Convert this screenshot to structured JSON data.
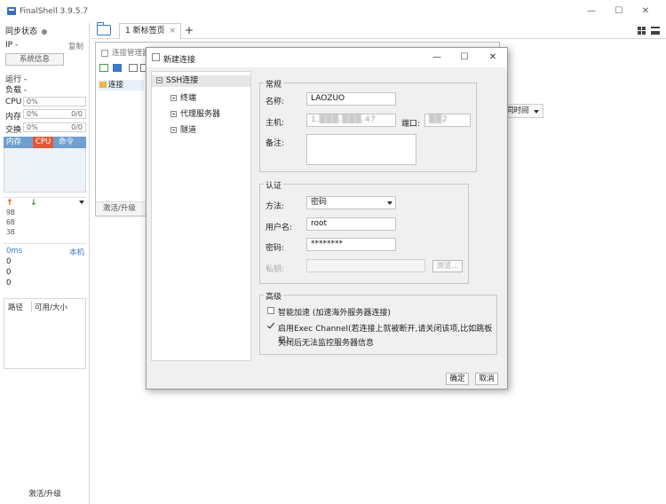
{
  "app": {
    "title": "FinalShell 3.9.5.7"
  },
  "sidebar": {
    "sync_label": "同步状态",
    "ip_label": "IP -",
    "copy_label": "复制",
    "sysinfo_button": "系统信息",
    "running_label": "运行 -",
    "load_label": "负载 -",
    "cpu": {
      "label": "CPU",
      "value": "0%"
    },
    "mem": {
      "label": "内存",
      "value": "0%",
      "right": "0/0"
    },
    "swap": {
      "label": "交换",
      "value": "0%",
      "right": "0/0"
    },
    "proc_tabs": [
      "内存",
      "CPU",
      "命令"
    ],
    "net_labels": [
      "9B",
      "6B",
      "3B"
    ],
    "ping": {
      "value": "0ms",
      "host": "本机",
      "rows": [
        "0",
        "0",
        "0"
      ]
    },
    "disk_headers": [
      "路径",
      "可用/大小"
    ],
    "upgrade": "激活/升级"
  },
  "tabs": {
    "items": [
      {
        "label": "1 新标签页",
        "close": "×"
      }
    ],
    "add": "+"
  },
  "conn_manager": {
    "title": "连接管理器",
    "row": "连接",
    "footer": "激活/升级"
  },
  "time_select": "同时间",
  "dialog": {
    "title": "新建连接",
    "tree": {
      "root": "SSH连接",
      "children": [
        "终端",
        "代理服务器",
        "隧道"
      ]
    },
    "general": {
      "title": "常规",
      "name_label": "名称:",
      "name_value": "LAOZUO",
      "host_label": "主机:",
      "host_value": "1.▒▒▒.▒▒▒.47",
      "port_label": "端口:",
      "port_value": "▒▒2",
      "note_label": "备注:"
    },
    "auth": {
      "title": "认证",
      "method_label": "方法:",
      "method_value": "密码",
      "user_label": "用户名:",
      "user_value": "root",
      "pass_label": "密码:",
      "pass_value": "********",
      "key_label": "私钥:",
      "browse": "浏览..."
    },
    "advanced": {
      "title": "高级",
      "smart_accel": "智能加速 (加速海外服务器连接)",
      "exec_channel": "启用Exec Channel(若连接上就被断开,请关闭该项,比如跳板机)",
      "exec_note": "关闭后无法监控服务器信息"
    },
    "buttons": {
      "ok": "确定",
      "cancel": "取消"
    },
    "window": {
      "minimize": "—",
      "maximize": "☐",
      "close": "✕"
    }
  },
  "main_window": {
    "minimize": "—",
    "maximize": "☐",
    "close": "✕"
  }
}
